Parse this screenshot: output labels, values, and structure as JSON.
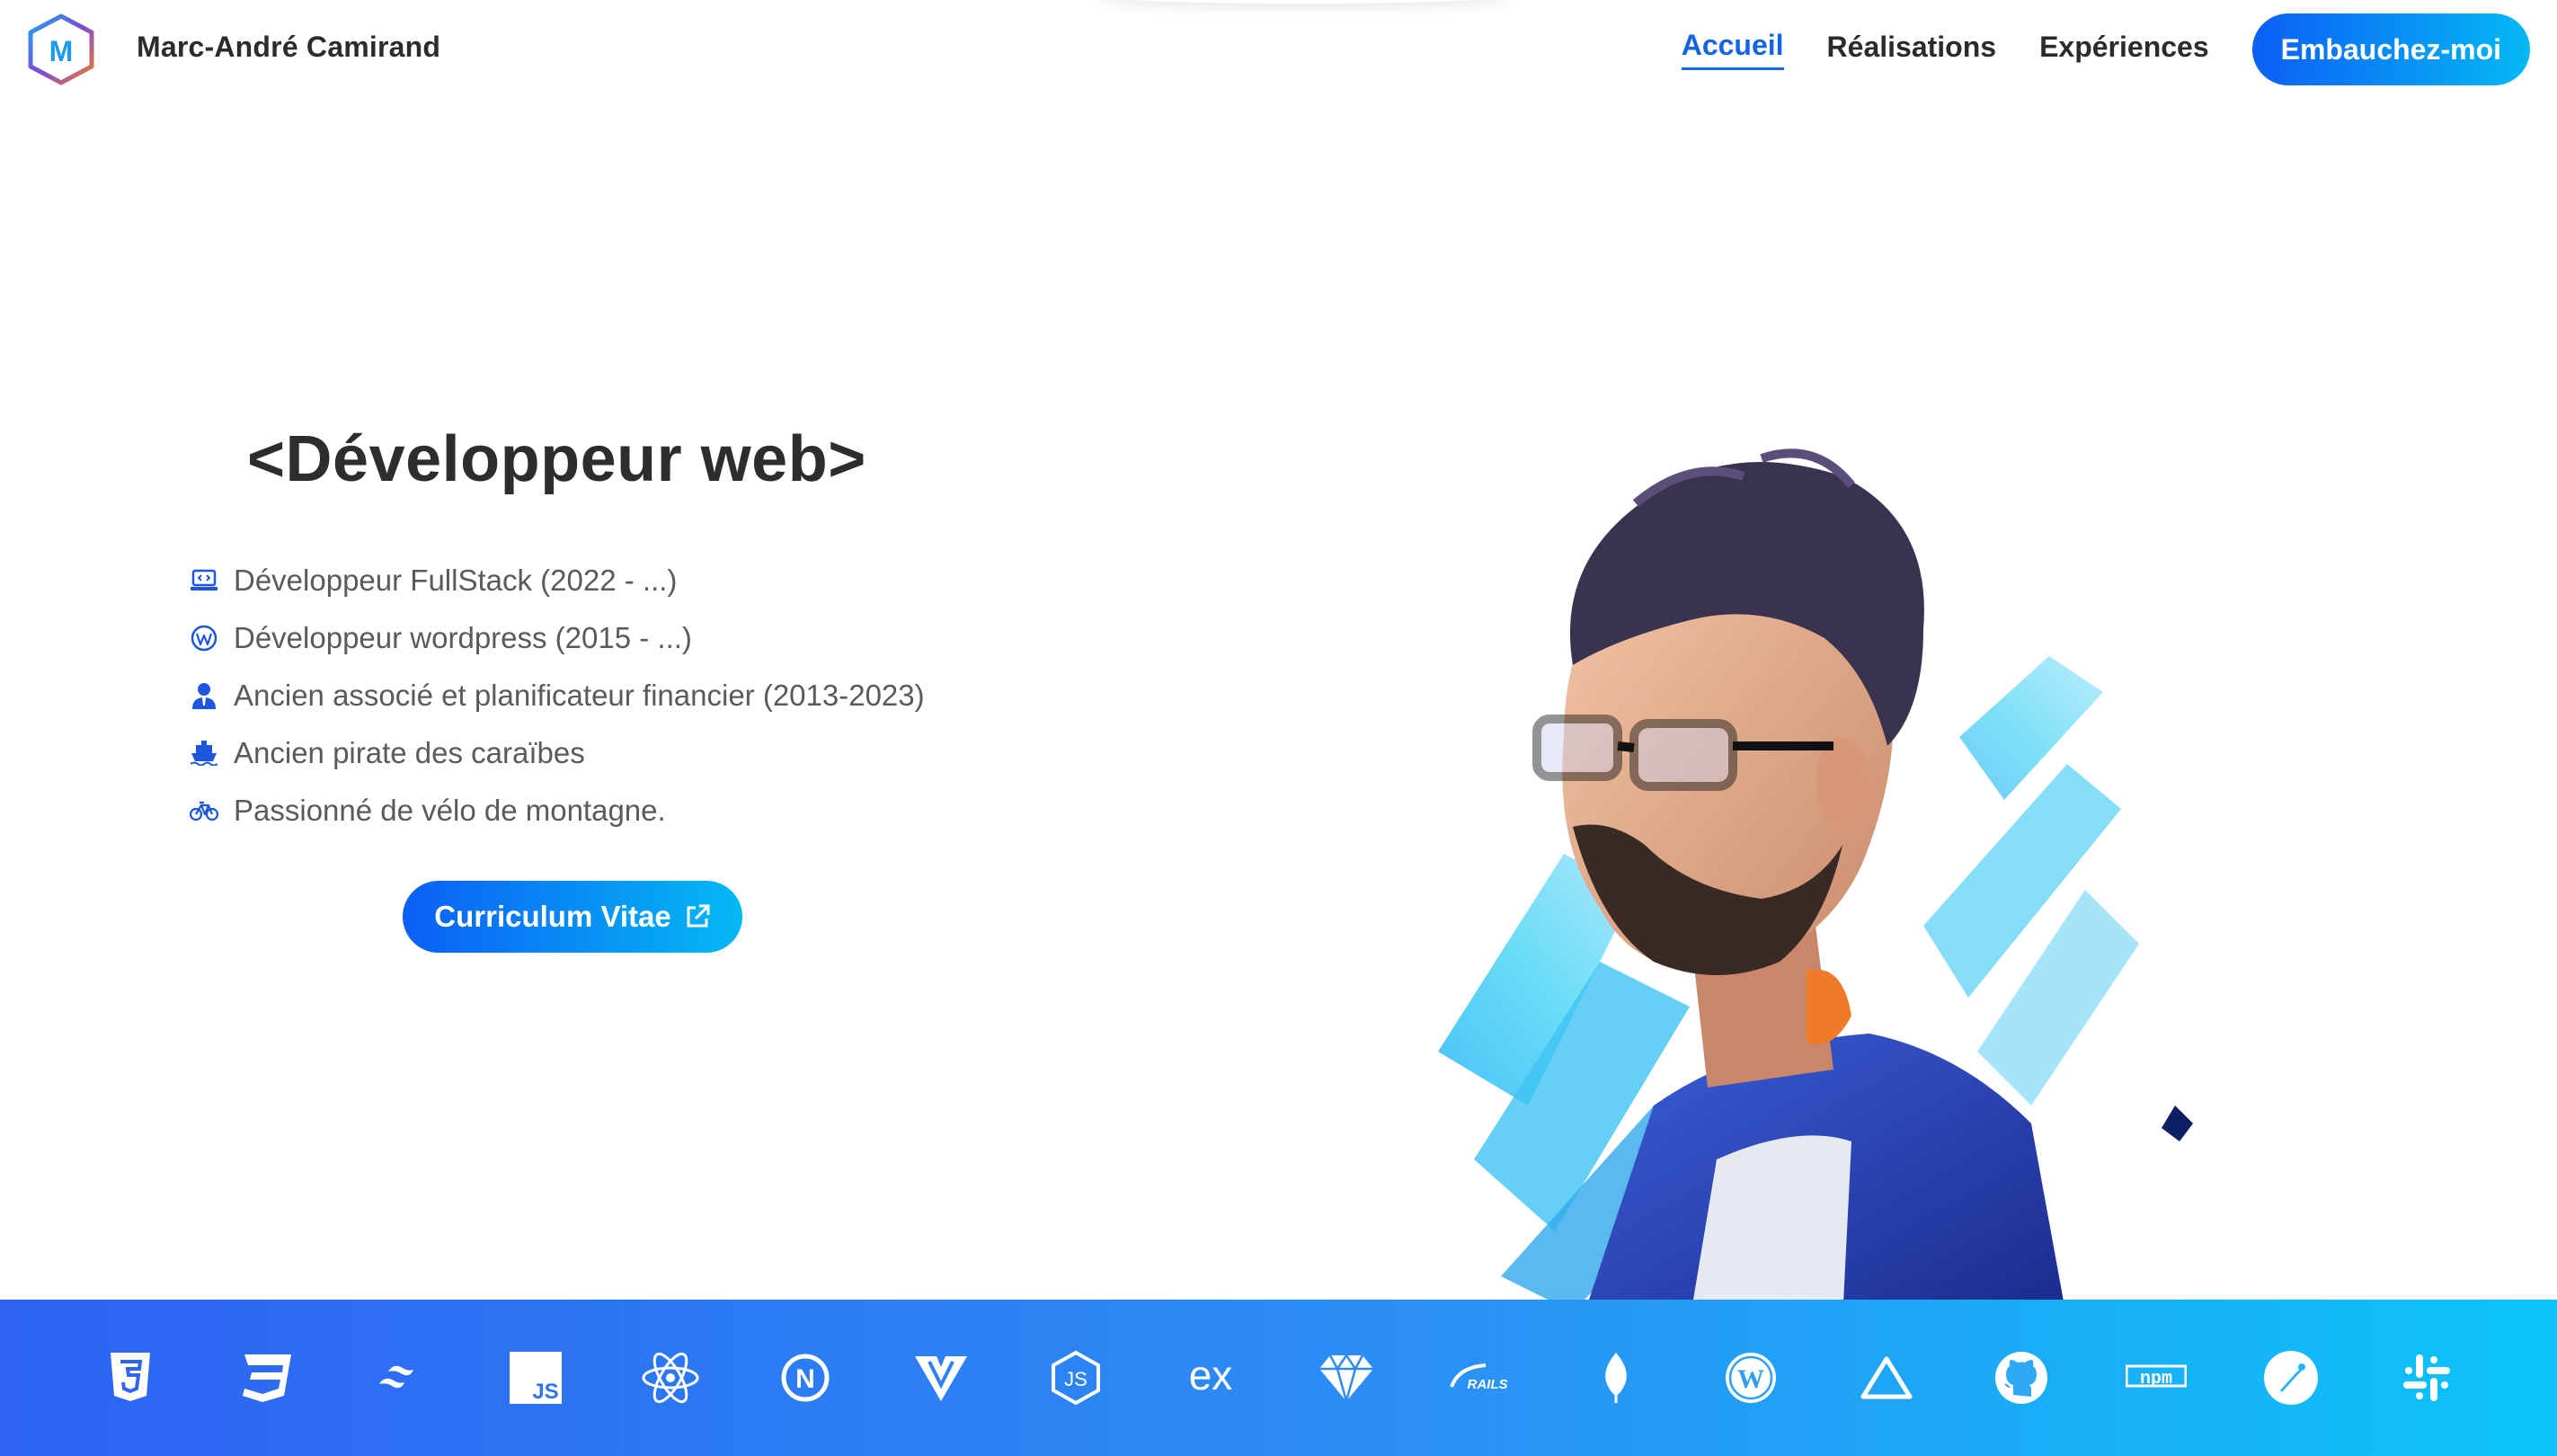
{
  "header": {
    "logo_letter": "M",
    "site_name": "Marc-André Camirand",
    "nav": [
      {
        "label": "Accueil",
        "active": true
      },
      {
        "label": "Réalisations",
        "active": false
      },
      {
        "label": "Expériences",
        "active": false
      }
    ],
    "hire_label": "Embauchez-moi"
  },
  "hero": {
    "title": "<Développeur web>",
    "bullets": [
      {
        "icon": "code-laptop-icon",
        "text": "Développeur FullStack (2022 - ...)"
      },
      {
        "icon": "wordpress-icon",
        "text": "Développeur wordpress (2015 - ...)"
      },
      {
        "icon": "user-tie-icon",
        "text": "Ancien associé et planificateur financier (2013-2023)"
      },
      {
        "icon": "ship-icon",
        "text": "Ancien pirate des caraïbes"
      },
      {
        "icon": "bicycle-icon",
        "text": "Passionné de vélo de montagne."
      }
    ],
    "cv_label": "Curriculum Vitae",
    "portrait": "developer-portrait-illustration"
  },
  "tech": [
    {
      "icon": "html5-icon"
    },
    {
      "icon": "css3-icon"
    },
    {
      "icon": "tailwind-icon"
    },
    {
      "icon": "javascript-icon",
      "text": "JS"
    },
    {
      "icon": "react-icon"
    },
    {
      "icon": "nextjs-icon",
      "text": "N"
    },
    {
      "icon": "vuetify-icon"
    },
    {
      "icon": "nodejs-icon",
      "text": "JS"
    },
    {
      "icon": "express-icon",
      "text": "ex"
    },
    {
      "icon": "ruby-icon"
    },
    {
      "icon": "rails-icon",
      "text": "RAILS"
    },
    {
      "icon": "mongodb-icon"
    },
    {
      "icon": "wordpress-icon",
      "text": "W"
    },
    {
      "icon": "vercel-icon"
    },
    {
      "icon": "github-icon"
    },
    {
      "icon": "npm-icon",
      "text": "npm"
    },
    {
      "icon": "postman-icon"
    },
    {
      "icon": "slack-icon"
    }
  ],
  "colors": {
    "accent": "#1465e6",
    "gradient_start": "#0b5ff5",
    "gradient_end": "#05b9f4",
    "techbar_start": "#2d62f2",
    "techbar_end": "#0cc4f7"
  }
}
